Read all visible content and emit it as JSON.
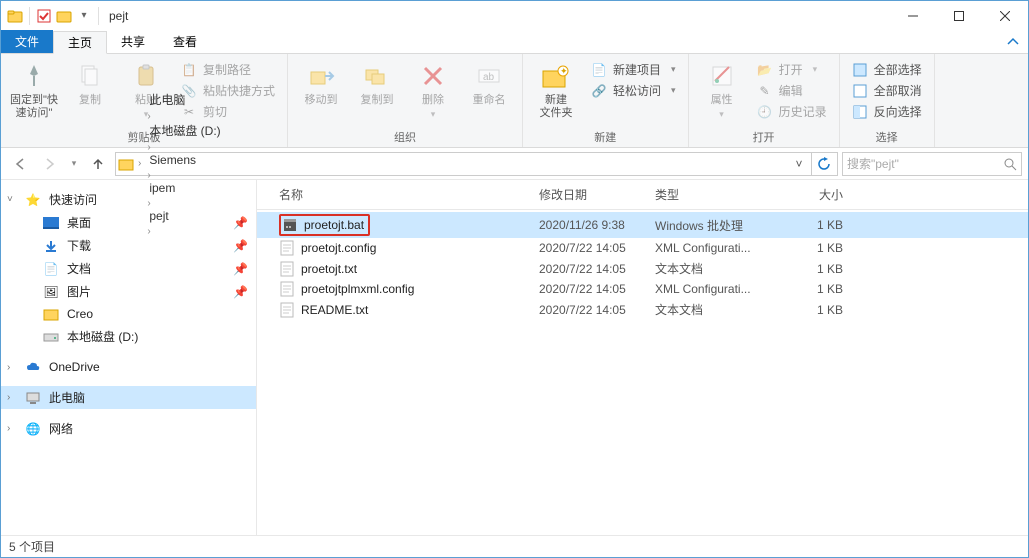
{
  "title_folder": "pejt",
  "qat": {
    "checkbox_visible": true
  },
  "tabs": {
    "file": "文件",
    "home": "主页",
    "share": "共享",
    "view": "查看"
  },
  "ribbon": {
    "clipboard": {
      "pin": "固定到\"快\n速访问\"",
      "copy": "复制",
      "paste": "粘贴",
      "copy_path": "复制路径",
      "paste_shortcut": "粘贴快捷方式",
      "cut": "剪切",
      "group": "剪贴板"
    },
    "organize": {
      "move": "移动到",
      "copy_to": "复制到",
      "delete": "删除",
      "rename": "重命名",
      "group": "组织"
    },
    "new": {
      "new_folder": "新建\n文件夹",
      "new_item": "新建项目",
      "easy_access": "轻松访问",
      "group": "新建"
    },
    "open": {
      "properties": "属性",
      "open": "打开",
      "edit": "编辑",
      "history": "历史记录",
      "group": "打开"
    },
    "select": {
      "select_all": "全部选择",
      "select_none": "全部取消",
      "invert": "反向选择",
      "group": "选择"
    }
  },
  "breadcrumbs": [
    "此电脑",
    "本地磁盘 (D:)",
    "Siemens",
    "ipem",
    "pejt"
  ],
  "search_placeholder": "搜索\"pejt\"",
  "sidebar": {
    "quick": "快速访问",
    "desktop": "桌面",
    "downloads": "下载",
    "documents": "文档",
    "pictures": "图片",
    "creo": "Creo",
    "local_d": "本地磁盘 (D:)",
    "onedrive": "OneDrive",
    "thispc": "此电脑",
    "network": "网络"
  },
  "columns": {
    "name": "名称",
    "date": "修改日期",
    "type": "类型",
    "size": "大小"
  },
  "files": [
    {
      "name": "proetojt.bat",
      "date": "2020/11/26 9:38",
      "type": "Windows 批处理",
      "size": "1 KB",
      "icon": "bat",
      "selected": true,
      "highlight": true
    },
    {
      "name": "proetojt.config",
      "date": "2020/7/22 14:05",
      "type": "XML Configurati...",
      "size": "1 KB",
      "icon": "txt"
    },
    {
      "name": "proetojt.txt",
      "date": "2020/7/22 14:05",
      "type": "文本文档",
      "size": "1 KB",
      "icon": "txt"
    },
    {
      "name": "proetojtplmxml.config",
      "date": "2020/7/22 14:05",
      "type": "XML Configurati...",
      "size": "1 KB",
      "icon": "txt"
    },
    {
      "name": "README.txt",
      "date": "2020/7/22 14:05",
      "type": "文本文档",
      "size": "1 KB",
      "icon": "txt"
    }
  ],
  "status": "5 个项目"
}
